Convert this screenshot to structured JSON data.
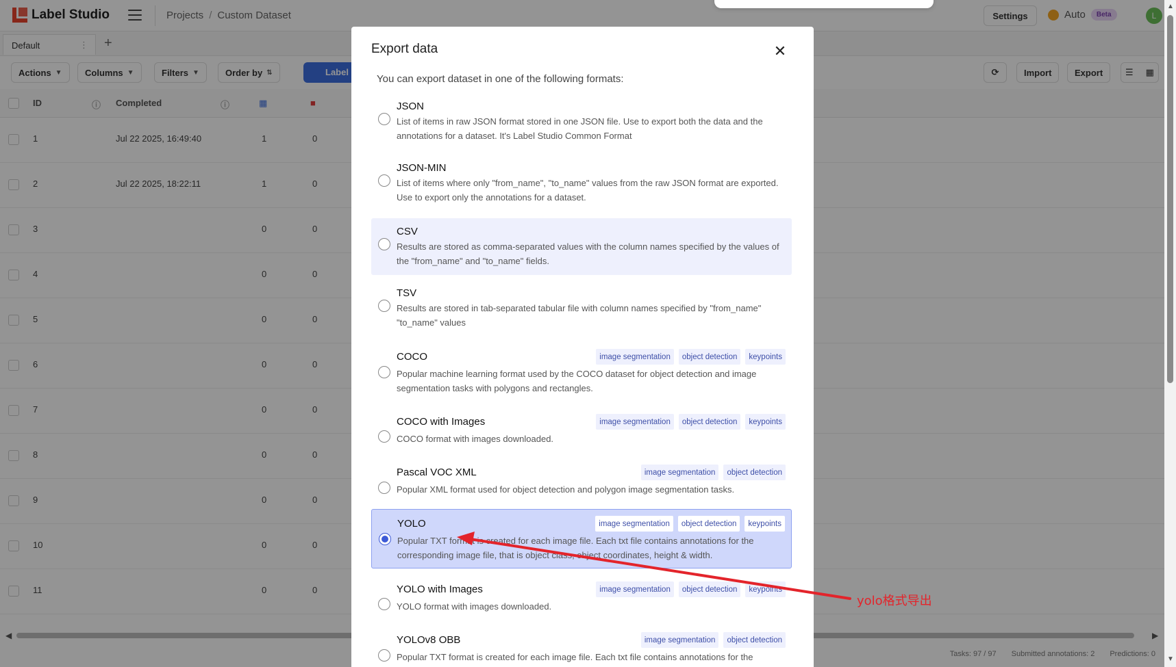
{
  "app": {
    "name": "Label Studio",
    "breadcrumb": [
      "Projects",
      "Custom Dataset"
    ],
    "settings_label": "Settings",
    "auto_label": "Auto",
    "beta_label": "Beta",
    "avatar_initial": "L",
    "tab_default": "Default",
    "toolbar": {
      "actions": "Actions",
      "columns": "Columns",
      "filters": "Filters",
      "order_by": "Order by",
      "label_btn": "Label",
      "import": "Import",
      "export": "Export"
    },
    "columns": [
      "ID",
      "Completed"
    ],
    "rows": [
      {
        "id": "1",
        "completed": "Jul 22 2025, 16:49:40",
        "a": "1",
        "b": "0"
      },
      {
        "id": "2",
        "completed": "Jul 22 2025, 18:22:11",
        "a": "1",
        "b": "0"
      },
      {
        "id": "3",
        "completed": "",
        "a": "0",
        "b": "0"
      },
      {
        "id": "4",
        "completed": "",
        "a": "0",
        "b": "0"
      },
      {
        "id": "5",
        "completed": "",
        "a": "0",
        "b": "0"
      },
      {
        "id": "6",
        "completed": "",
        "a": "0",
        "b": "0"
      },
      {
        "id": "7",
        "completed": "",
        "a": "0",
        "b": "0"
      },
      {
        "id": "8",
        "completed": "",
        "a": "0",
        "b": "0"
      },
      {
        "id": "9",
        "completed": "",
        "a": "0",
        "b": "0"
      },
      {
        "id": "10",
        "completed": "",
        "a": "0",
        "b": "0"
      },
      {
        "id": "11",
        "completed": "",
        "a": "0",
        "b": "0"
      }
    ],
    "footer": {
      "tasks": "Tasks: 97 / 97",
      "submitted": "Submitted annotations: 2",
      "predictions": "Predictions: 0"
    }
  },
  "modal": {
    "title": "Export data",
    "close_icon": "close-icon",
    "subtitle": "You can export dataset in one of the following formats:",
    "options": [
      {
        "name": "JSON",
        "desc": "List of items in raw JSON format stored in one JSON file. Use to export both the data and the annotations for a dataset. It's Label Studio Common Format",
        "tags": []
      },
      {
        "name": "JSON-MIN",
        "desc": "List of items where only \"from_name\", \"to_name\" values from the raw JSON format are exported. Use to export only the annotations for a dataset.",
        "tags": []
      },
      {
        "name": "CSV",
        "desc": "Results are stored as comma-separated values with the column names specified by the values of the \"from_name\" and \"to_name\" fields.",
        "tags": []
      },
      {
        "name": "TSV",
        "desc": "Results are stored in tab-separated tabular file with column names specified by \"from_name\" \"to_name\" values",
        "tags": []
      },
      {
        "name": "COCO",
        "desc": "Popular machine learning format used by the COCO dataset for object detection and image segmentation tasks with polygons and rectangles.",
        "tags": [
          "image segmentation",
          "object detection",
          "keypoints"
        ]
      },
      {
        "name": "COCO with Images",
        "desc": "COCO format with images downloaded.",
        "tags": [
          "image segmentation",
          "object detection",
          "keypoints"
        ]
      },
      {
        "name": "Pascal VOC XML",
        "desc": "Popular XML format used for object detection and polygon image segmentation tasks.",
        "tags": [
          "image segmentation",
          "object detection"
        ]
      },
      {
        "name": "YOLO",
        "desc": "Popular TXT format is created for each image file. Each txt file contains annotations for the corresponding image file, that is object class, object coordinates, height & width.",
        "tags": [
          "image segmentation",
          "object detection",
          "keypoints"
        ]
      },
      {
        "name": "YOLO with Images",
        "desc": "YOLO format with images downloaded.",
        "tags": [
          "image segmentation",
          "object detection",
          "keypoints"
        ]
      },
      {
        "name": "YOLOv8 OBB",
        "desc": "Popular TXT format is created for each image file. Each txt file contains annotations for the",
        "tags": [
          "image segmentation",
          "object detection"
        ]
      }
    ],
    "selected": "YOLO",
    "hovered": "CSV"
  },
  "annotation": {
    "label": "yolo格式导出",
    "color": "#e3242b"
  },
  "colors": {
    "accent": "#3d5ad6",
    "selected_bg": "#cfd7fb",
    "tag_text": "#3e4fa8"
  }
}
